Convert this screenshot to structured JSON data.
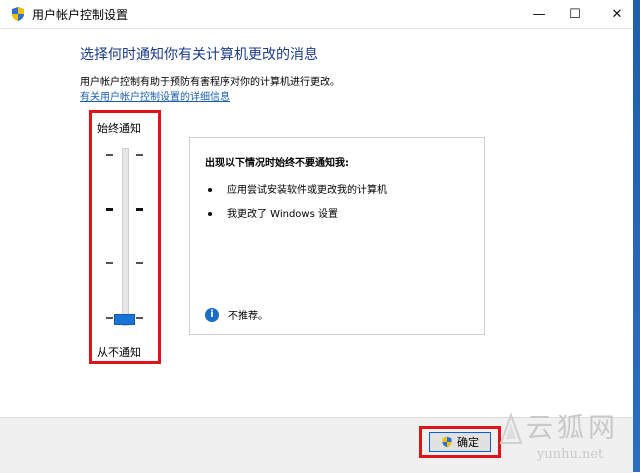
{
  "window": {
    "title": "用户帐户控制设置",
    "controls": {
      "minimize": "—",
      "maximize": "☐",
      "close": "✕"
    }
  },
  "main": {
    "heading": "选择何时通知你有关计算机更改的消息",
    "description": "用户帐户控制有助于预防有害程序对你的计算机进行更改。",
    "link": "有关用户帐户控制设置的详细信息"
  },
  "slider": {
    "label_top": "始终通知",
    "label_bottom": "从不通知",
    "levels": 4,
    "selected_level": 1
  },
  "panel": {
    "title": "出现以下情况时始终不要通知我:",
    "bullets": [
      "应用尝试安装软件或更改我的计算机",
      "我更改了 Windows 设置"
    ],
    "note": "不推荐。"
  },
  "footer": {
    "ok_label": "确定"
  },
  "watermark": {
    "brand": "云狐网",
    "url": "yunhu.net"
  },
  "colors": {
    "heading": "#1b3a8a",
    "link": "#1a5fb4",
    "highlight": "#e0121a",
    "accent": "#1a73d6"
  },
  "icons": {
    "title": "uac-shield-icon",
    "info": "info-icon",
    "ok": "uac-shield-icon"
  }
}
